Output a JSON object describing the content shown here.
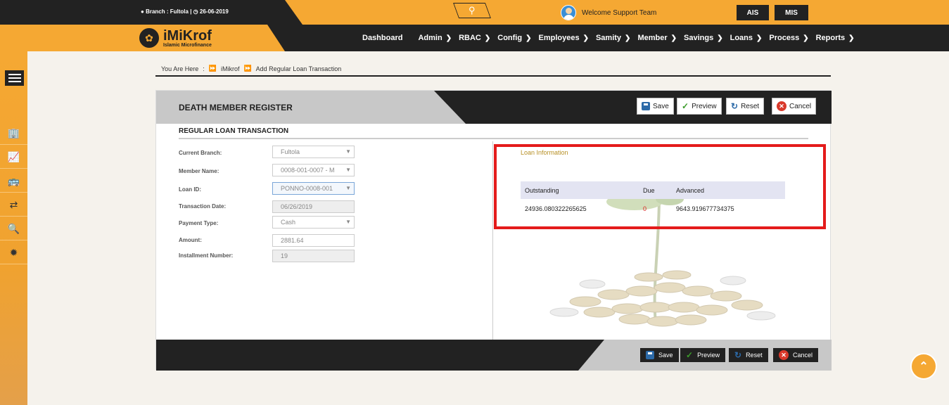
{
  "topbar": {
    "branch_info": "Branch : Fultola |",
    "date": "26-06-2019",
    "welcome": "Welcome Support Team",
    "ais_label": "AIS",
    "mis_label": "MIS"
  },
  "logo": {
    "title": "iMiKrof",
    "subtitle": "Islamic Microfinance"
  },
  "nav": {
    "items": [
      "Dashboard",
      "Admin",
      "RBAC",
      "Config",
      "Employees",
      "Samity",
      "Member",
      "Savings",
      "Loans",
      "Process",
      "Reports"
    ]
  },
  "breadcrumb": {
    "you_are_here": "You Are Here",
    "sep": ":",
    "home": "iMikrof",
    "current": "Add Regular Loan Transaction"
  },
  "panel": {
    "title": "DEATH MEMBER REGISTER",
    "section_title": "REGULAR LOAN TRANSACTION",
    "buttons": {
      "save": "Save",
      "preview": "Preview",
      "reset": "Reset",
      "cancel": "Cancel"
    }
  },
  "form": {
    "current_branch_label": "Current Branch:",
    "current_branch_value": "Fultola",
    "member_name_label": "Member Name:",
    "member_name_value": "0008-001-0007 - M",
    "loan_id_label": "Loan ID:",
    "loan_id_value": "PONNO-0008-001",
    "transaction_date_label": "Transaction Date:",
    "transaction_date_value": "06/26/2019",
    "payment_type_label": "Payment Type:",
    "payment_type_value": "Cash",
    "amount_label": "Amount:",
    "amount_value": "2881.64",
    "installment_label": "Installment Number:",
    "installment_value": "19"
  },
  "loan_info": {
    "title": "Loan Information",
    "headers": [
      "Outstanding",
      "Due",
      "Advanced"
    ],
    "outstanding": "24936.080322265625",
    "due": "0",
    "advanced": "9643.919677734375"
  },
  "colors": {
    "accent": "#f5a833",
    "dark": "#222222",
    "highlight": "#e41b1b"
  },
  "icons": {
    "scroll_top": "chevron-up-icon",
    "menu": "hamburger-icon"
  }
}
